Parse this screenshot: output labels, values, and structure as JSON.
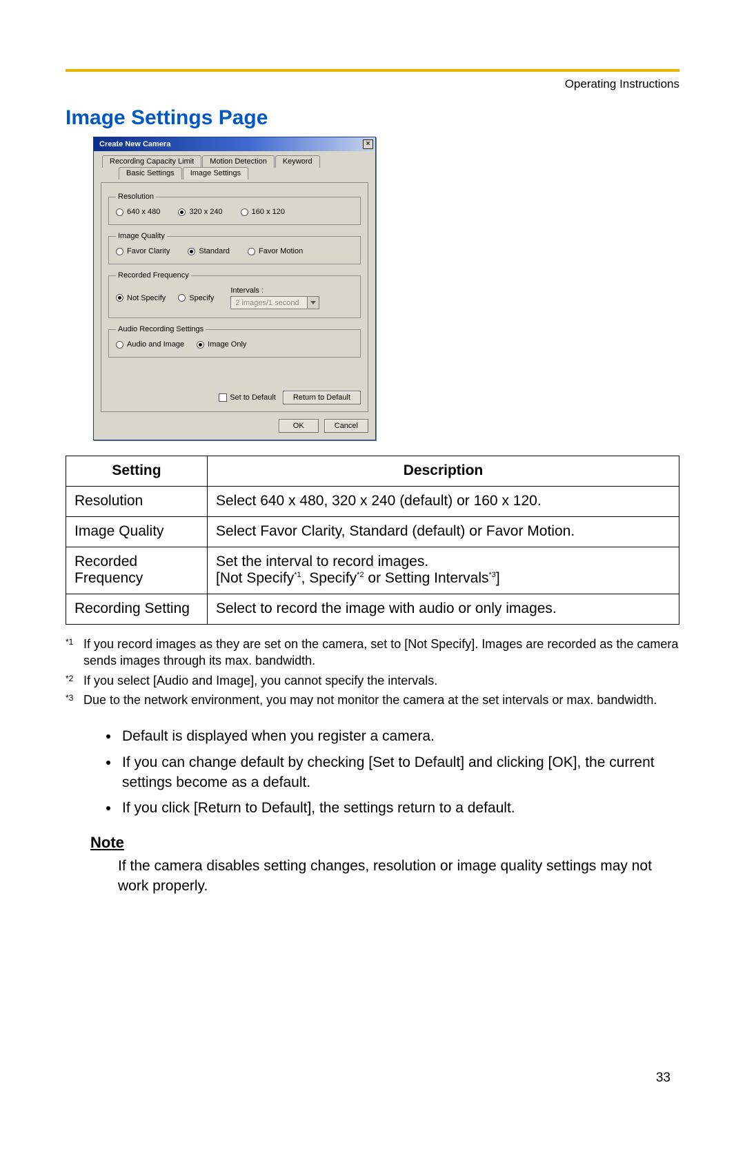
{
  "header": {
    "running": "Operating Instructions",
    "page_number": "33"
  },
  "section": {
    "title": "Image Settings Page"
  },
  "dialog": {
    "title": "Create New Camera",
    "tabs": {
      "row1": [
        "Recording Capacity Limit",
        "Motion Detection",
        "Keyword"
      ],
      "row2": [
        "Basic Settings",
        "Image Settings"
      ],
      "active": "Image Settings"
    },
    "groups": {
      "resolution": {
        "legend": "Resolution",
        "options": [
          "640 x 480",
          "320 x 240",
          "160 x 120"
        ],
        "selected": "320 x 240"
      },
      "image_quality": {
        "legend": "Image Quality",
        "options": [
          "Favor Clarity",
          "Standard",
          "Favor Motion"
        ],
        "selected": "Standard"
      },
      "recorded_frequency": {
        "legend": "Recorded Frequency",
        "options": [
          "Not Specify",
          "Specify"
        ],
        "selected": "Not Specify",
        "intervals_label": "Intervals :",
        "intervals_value": "2 images/1 second"
      },
      "audio": {
        "legend": "Audio Recording Settings",
        "options": [
          "Audio and Image",
          "Image Only"
        ],
        "selected": "Image Only"
      }
    },
    "set_default_label": "Set to Default",
    "return_default_button": "Return to Default",
    "ok_button": "OK",
    "cancel_button": "Cancel"
  },
  "table": {
    "head": {
      "setting": "Setting",
      "description": "Description"
    },
    "rows": [
      {
        "setting": "Resolution",
        "desc": "Select 640 x 480, 320 x 240 (default) or 160 x 120."
      },
      {
        "setting": "Image Quality",
        "desc": "Select Favor Clarity, Standard (default) or Favor Motion."
      },
      {
        "setting": "Recorded Frequency",
        "desc_line1": "Set the interval to record images.",
        "desc_line2_pre": "[Not Specify",
        "desc_line2_mid1": ", Specify",
        "desc_line2_mid2": " or Setting Intervals",
        "desc_line2_post": "]",
        "sup1": "*1",
        "sup2": "*2",
        "sup3": "*3"
      },
      {
        "setting": "Recording Setting",
        "desc": "Select to record the image with audio or only images."
      }
    ]
  },
  "footnotes": [
    {
      "mark": "*1",
      "text": "If you record images as they are set on the camera, set to [Not Specify]. Images are recorded as the camera sends images through its max. bandwidth."
    },
    {
      "mark": "*2",
      "text": "If you select [Audio and Image], you cannot specify the intervals."
    },
    {
      "mark": "*3",
      "text": "Due to the network environment, you may not monitor the camera at the set intervals or max. bandwidth."
    }
  ],
  "bullets": [
    "Default is displayed when you register a camera.",
    "If you can change default by checking [Set to Default] and clicking [OK], the current settings become as a default.",
    "If you click [Return to Default], the settings return to a default."
  ],
  "note": {
    "heading": "Note",
    "body": "If the camera disables setting changes, resolution or image quality settings may not work properly."
  }
}
